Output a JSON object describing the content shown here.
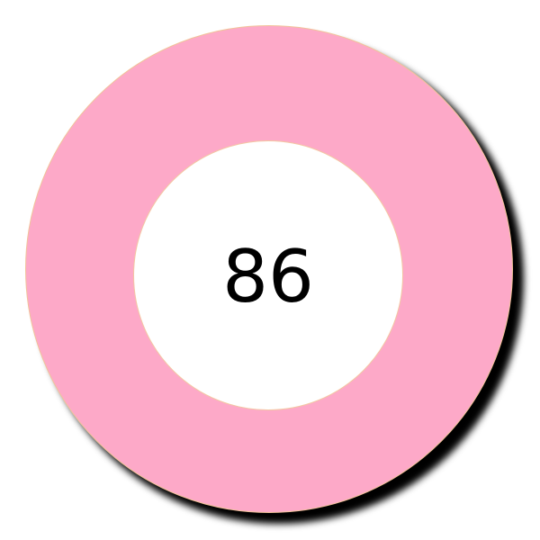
{
  "badge": {
    "value": "86",
    "ring_color": "#fda9c8",
    "center_color": "#ffffff",
    "shadow_color": "#000000",
    "text_color": "#000000"
  }
}
